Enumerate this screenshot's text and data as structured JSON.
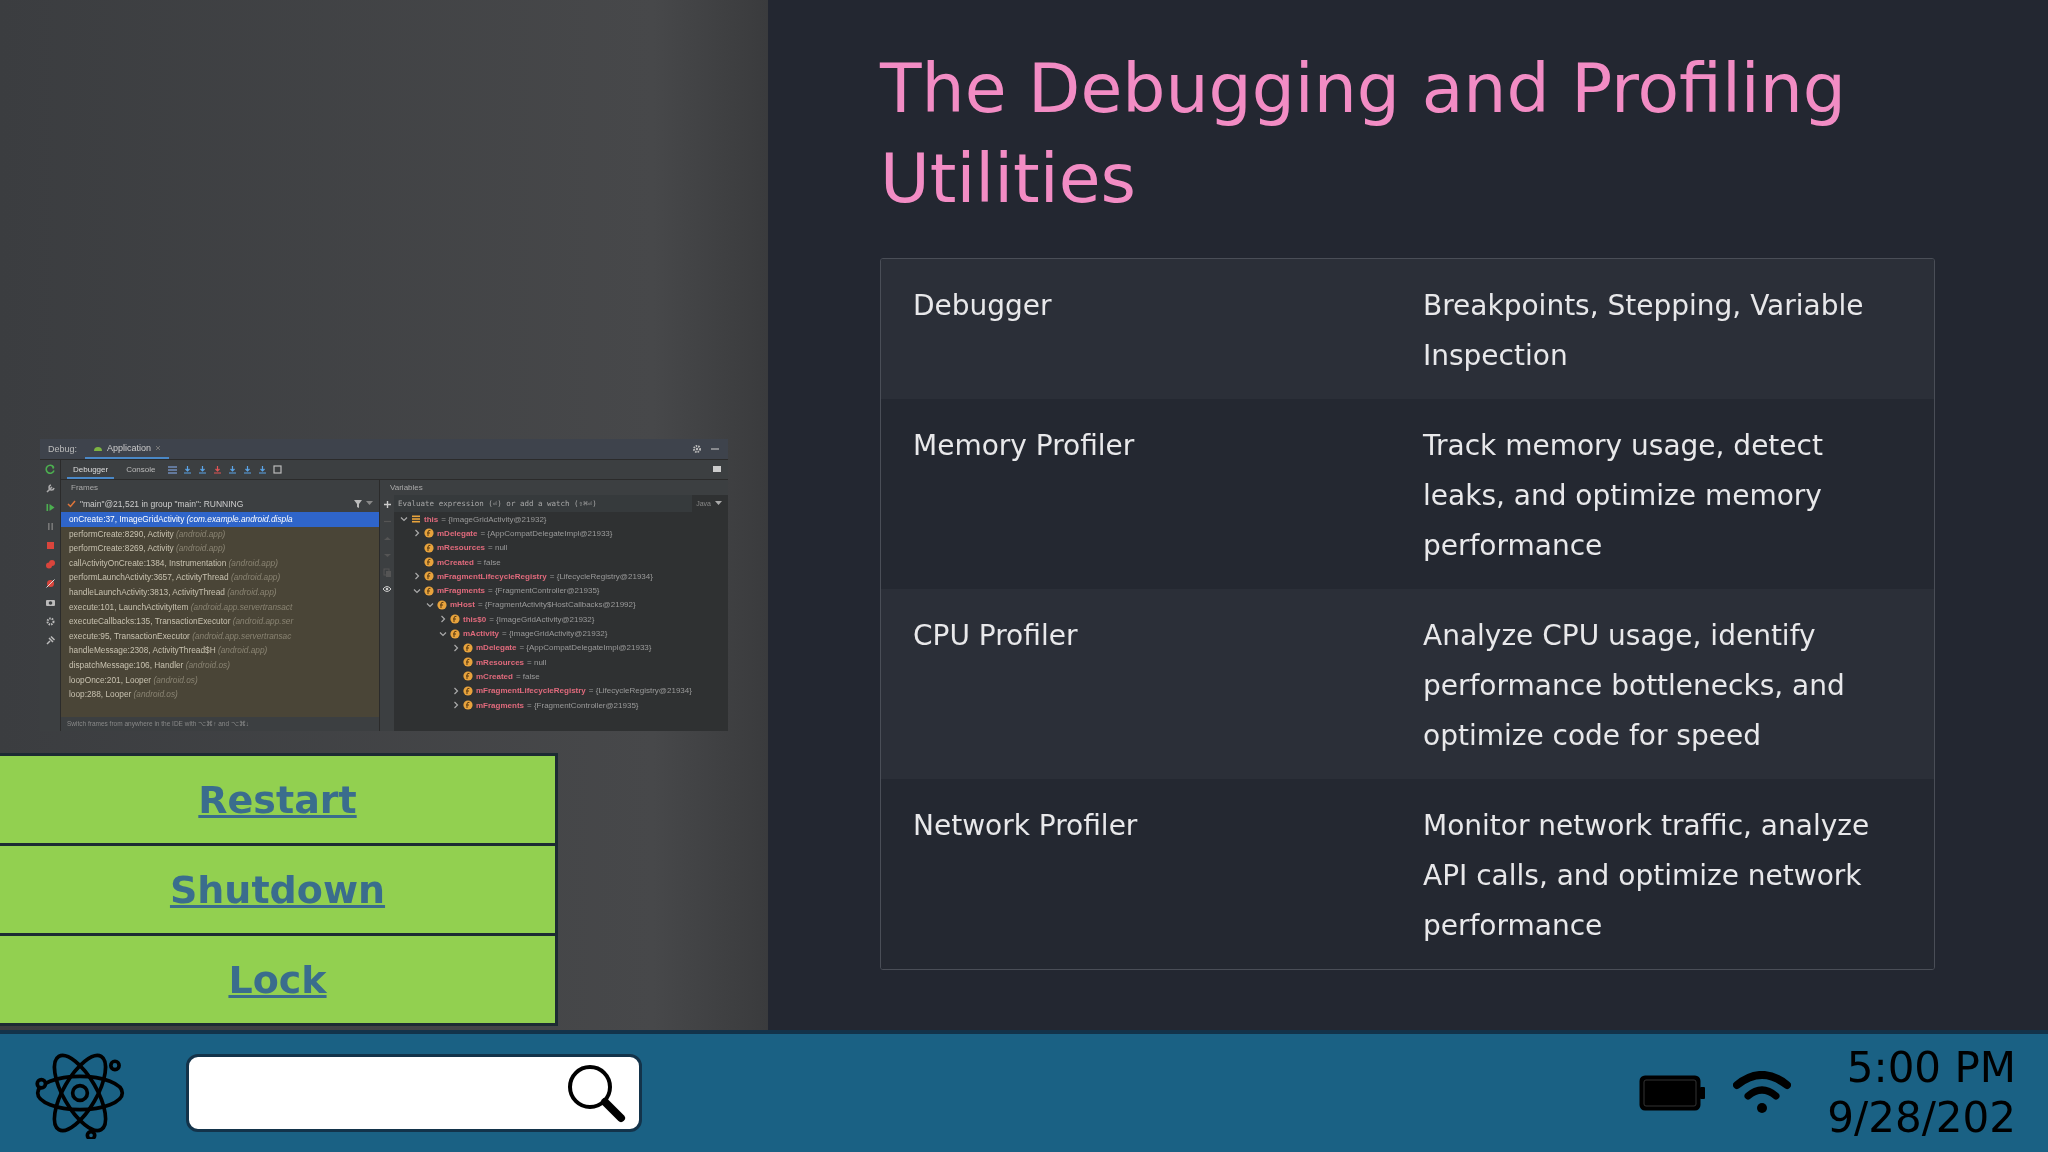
{
  "ide": {
    "tool_label": "Debug:",
    "tab": "Application",
    "subtabs": [
      {
        "label": "Debugger",
        "selected": true
      },
      {
        "label": "Console",
        "selected": false
      }
    ],
    "frames_title": "Frames",
    "thread": "\"main\"@21,521 in group \"main\": RUNNING",
    "frames": [
      {
        "method": "onCreate:37, ImageGridActivity",
        "package": "(com.example.android.displa",
        "selected": true
      },
      {
        "method": "performCreate:8290, Activity",
        "package": "(android.app)",
        "selected": false
      },
      {
        "method": "performCreate:8269, Activity",
        "package": "(android.app)",
        "selected": false
      },
      {
        "method": "callActivityOnCreate:1384, Instrumentation",
        "package": "(android.app)",
        "selected": false
      },
      {
        "method": "performLaunchActivity:3657, ActivityThread",
        "package": "(android.app)",
        "selected": false
      },
      {
        "method": "handleLaunchActivity:3813, ActivityThread",
        "package": "(android.app)",
        "selected": false
      },
      {
        "method": "execute:101, LaunchActivityItem",
        "package": "(android.app.servertransact",
        "selected": false
      },
      {
        "method": "executeCallbacks:135, TransactionExecutor",
        "package": "(android.app.ser",
        "selected": false
      },
      {
        "method": "execute:95, TransactionExecutor",
        "package": "(android.app.servertransac",
        "selected": false
      },
      {
        "method": "handleMessage:2308, ActivityThread$H",
        "package": "(android.app)",
        "selected": false
      },
      {
        "method": "dispatchMessage:106, Handler",
        "package": "(android.os)",
        "selected": false
      },
      {
        "method": "loopOnce:201, Looper",
        "package": "(android.os)",
        "selected": false
      },
      {
        "method": "loop:288, Looper",
        "package": "(android.os)",
        "selected": false
      }
    ],
    "hint": "Switch frames from anywhere in the IDE with ⌥⌘↑ and ⌥⌘↓",
    "variables_title": "Variables",
    "watch_placeholder": "Evaluate expression (⏎) or add a watch (⇧⌘⏎)",
    "language": "Java",
    "variables": [
      {
        "kind": "object",
        "name": "this",
        "value": "= {ImageGridActivity@21932}",
        "expanded": true,
        "children": [
          {
            "kind": "field",
            "name": "mDelegate",
            "value": "= {AppCompatDelegateImpl@21933}",
            "expanded": false
          },
          {
            "kind": "field",
            "name": "mResources",
            "value": "= null"
          },
          {
            "kind": "field",
            "name": "mCreated",
            "value": "= false"
          },
          {
            "kind": "field",
            "name": "mFragmentLifecycleRegistry",
            "value": "= {LifecycleRegistry@21934}",
            "expanded": false
          },
          {
            "kind": "field",
            "name": "mFragments",
            "value": "= {FragmentController@21935}",
            "expanded": true,
            "children": [
              {
                "kind": "field",
                "name": "mHost",
                "value": "= {FragmentActivity$HostCallbacks@21992}",
                "expanded": true,
                "children": [
                  {
                    "kind": "field",
                    "name": "this$0",
                    "value": "= {ImageGridActivity@21932}",
                    "expanded": false
                  },
                  {
                    "kind": "field",
                    "name": "mActivity",
                    "value": "= {ImageGridActivity@21932}",
                    "expanded": true,
                    "children": [
                      {
                        "kind": "field",
                        "name": "mDelegate",
                        "value": "= {AppCompatDelegateImpl@21933}",
                        "expanded": false
                      },
                      {
                        "kind": "field",
                        "name": "mResources",
                        "value": "= null"
                      },
                      {
                        "kind": "field",
                        "name": "mCreated",
                        "value": "= false"
                      },
                      {
                        "kind": "field",
                        "name": "mFragmentLifecycleRegistry",
                        "value": "= {LifecycleRegistry@21934}",
                        "expanded": false
                      },
                      {
                        "kind": "field",
                        "name": "mFragments",
                        "value": "= {FragmentController@21935}",
                        "expanded": false
                      }
                    ]
                  }
                ]
              }
            ]
          }
        ]
      }
    ]
  },
  "buttons": [
    "Restart",
    "Shutdown",
    "Lock"
  ],
  "title": "The Debugging and Profiling Utilities",
  "table": {
    "rows": [
      {
        "name": "Debugger",
        "description": "Breakpoints, Stepping, Variable Inspection"
      },
      {
        "name": "Memory Profiler",
        "description": "Track memory usage, detect leaks, and optimize memory performance"
      },
      {
        "name": "CPU Profiler",
        "description": "Analyze CPU usage, identify performance bottlenecks, and optimize code for speed"
      },
      {
        "name": "Network Profiler",
        "description": "Monitor network traffic, analyze API calls, and optimize network performance"
      }
    ]
  },
  "taskbar": {
    "time": "5:00 PM",
    "date": "9/28/202"
  }
}
